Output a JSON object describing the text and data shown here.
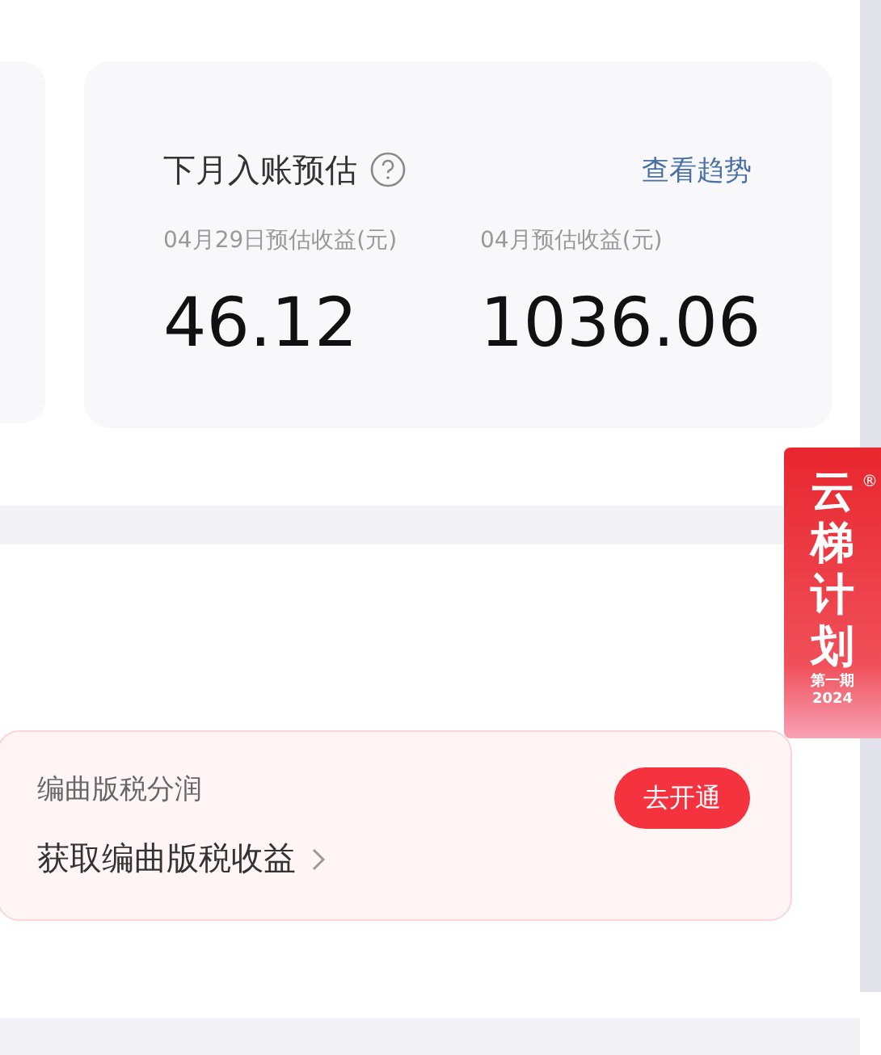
{
  "estimate_card": {
    "title": "下月入账预估",
    "trend_link": "查看趋势",
    "metrics": [
      {
        "label": "04月29日预估收益(元)",
        "value": "46.12"
      },
      {
        "label": "04月预估收益(元)",
        "value": "1036.06"
      }
    ]
  },
  "royalty_card": {
    "subtitle": "编曲版税分润",
    "title": "获取编曲版税收益",
    "button": "去开通"
  },
  "floating_badge": {
    "characters": [
      "云",
      "梯",
      "计",
      "划"
    ],
    "mark": "®",
    "issue": "第一期",
    "year": "2024"
  }
}
